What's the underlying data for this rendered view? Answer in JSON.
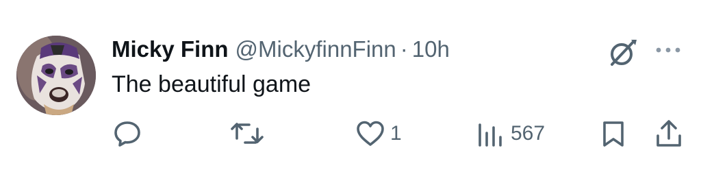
{
  "post": {
    "author": {
      "display_name": "Micky Finn",
      "handle": "@MickyfinnFinn",
      "avatar": "luchador-mask-avatar"
    },
    "separator": "·",
    "timestamp": "10h",
    "text": "The beautiful game"
  },
  "actions": {
    "reply": {
      "icon": "speech-bubble-icon",
      "count": ""
    },
    "repost": {
      "icon": "repost-arrows-icon",
      "count": ""
    },
    "like": {
      "icon": "heart-icon",
      "count": "1"
    },
    "views": {
      "icon": "bar-chart-icon",
      "count": "567"
    },
    "bookmark": {
      "icon": "bookmark-icon"
    },
    "share": {
      "icon": "share-upload-icon"
    }
  },
  "header_icons": {
    "grok": "grok-slash-circle-icon",
    "more": "ellipsis-icon"
  },
  "colors": {
    "text_primary": "#0f1419",
    "text_secondary": "#536471",
    "background": "#ffffff"
  }
}
